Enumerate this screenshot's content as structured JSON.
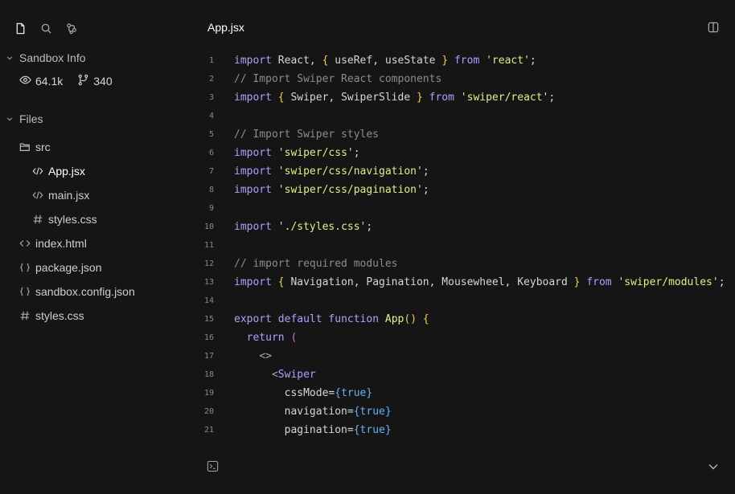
{
  "sidebar": {
    "icons": [
      "file-icon",
      "search-icon",
      "git-graph-icon"
    ],
    "sandbox_info": {
      "title": "Sandbox Info",
      "views": "64.1k",
      "forks": "340"
    },
    "files": {
      "title": "Files",
      "tree": {
        "src": "src",
        "app_jsx": "App.jsx",
        "main_jsx": "main.jsx",
        "src_styles": "styles.css",
        "index_html": "index.html",
        "package_json": "package.json",
        "sandbox_config": "sandbox.config.json",
        "root_styles": "styles.css"
      }
    }
  },
  "editor": {
    "tab_title": "App.jsx",
    "lines": [
      {
        "n": "1",
        "code": "import React, { useRef, useState } from 'react';"
      },
      {
        "n": "2",
        "code": "// Import Swiper React components"
      },
      {
        "n": "3",
        "code": "import { Swiper, SwiperSlide } from 'swiper/react';"
      },
      {
        "n": "4",
        "code": ""
      },
      {
        "n": "5",
        "code": "// Import Swiper styles"
      },
      {
        "n": "6",
        "code": "import 'swiper/css';"
      },
      {
        "n": "7",
        "code": "import 'swiper/css/navigation';"
      },
      {
        "n": "8",
        "code": "import 'swiper/css/pagination';"
      },
      {
        "n": "9",
        "code": ""
      },
      {
        "n": "10",
        "code": "import './styles.css';"
      },
      {
        "n": "11",
        "code": ""
      },
      {
        "n": "12",
        "code": "// import required modules"
      },
      {
        "n": "13",
        "code": "import { Navigation, Pagination, Mousewheel, Keyboard } from 'swiper/modules';"
      },
      {
        "n": "14",
        "code": ""
      },
      {
        "n": "15",
        "code": "export default function App() {"
      },
      {
        "n": "16",
        "code": "  return ("
      },
      {
        "n": "17",
        "code": "    <>"
      },
      {
        "n": "18",
        "code": "      <Swiper"
      },
      {
        "n": "19",
        "code": "        cssMode={true}"
      },
      {
        "n": "20",
        "code": "        navigation={true}"
      },
      {
        "n": "21",
        "code": "        pagination={true}"
      }
    ]
  }
}
